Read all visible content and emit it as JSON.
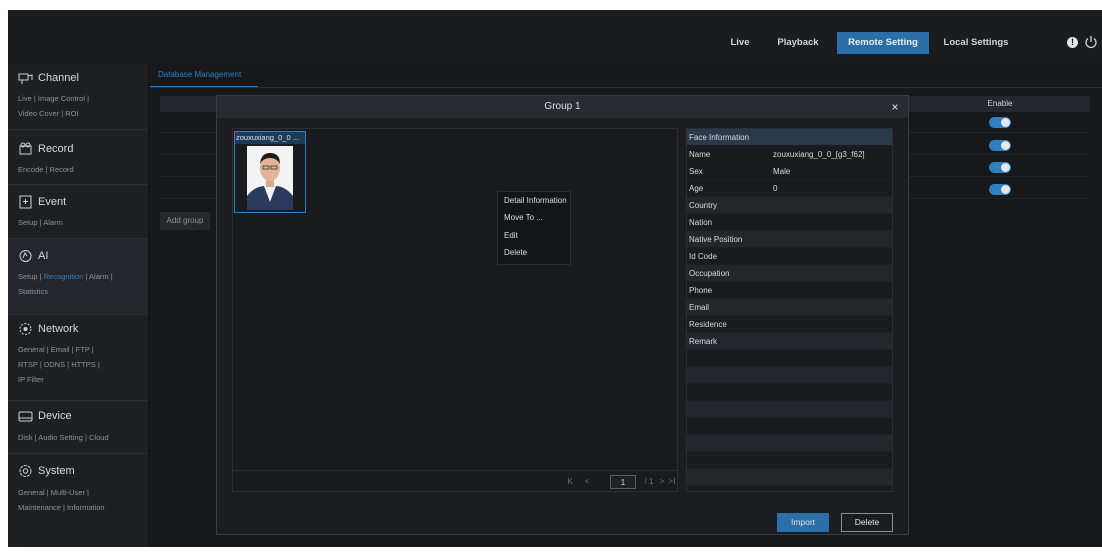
{
  "topbar": {
    "items": [
      {
        "label": "Live",
        "active": false
      },
      {
        "label": "Playback",
        "active": false
      },
      {
        "label": "Remote Setting",
        "active": true
      },
      {
        "label": "Local Settings",
        "active": false
      }
    ],
    "icons": [
      "alert-icon",
      "power-icon"
    ]
  },
  "sidebar": {
    "channel": {
      "title": "Channel",
      "links1": "Live | Image Control |",
      "links2": "Video Cover | ROI"
    },
    "record": {
      "title": "Record",
      "links1": "Encode | Record"
    },
    "event": {
      "title": "Event",
      "links1": "Setup | Alarm"
    },
    "ai": {
      "title": "AI",
      "l_setup": "Setup |",
      "l_recognition": "Recognition",
      "l_alarm": "| Alarm |",
      "links2": "Statistics"
    },
    "network": {
      "title": "Network",
      "links1": "General | Email | FTP |",
      "links2": "RTSP | DDNS | HTTPS |",
      "links3": "IP Filter"
    },
    "device": {
      "title": "Device",
      "links1": "Disk | Audio Setting | Cloud"
    },
    "system": {
      "title": "System",
      "links1": "General | Multi-User |",
      "links2": "Maintenance | Information"
    }
  },
  "main": {
    "tab": "Database Management",
    "enable_header": "Enable",
    "add_group": "Add group"
  },
  "dialog": {
    "title": "Group 1",
    "close": "×",
    "face_card_name": "zouxuxiang_0_0 ...",
    "context_menu": [
      "Detail Information",
      "Move To ...",
      "Edit",
      "Delete"
    ],
    "pager": {
      "first": "K",
      "prev": "<",
      "current": "1",
      "total": "/ 1",
      "next": ">",
      "last": ">I"
    },
    "info_header": "Face Information",
    "info_rows": [
      {
        "label": "Name",
        "value": "zouxuxiang_0_0_[g3_f62]"
      },
      {
        "label": "Sex",
        "value": "Male"
      },
      {
        "label": "Age",
        "value": "0"
      },
      {
        "label": "Country",
        "value": ""
      },
      {
        "label": "Nation",
        "value": ""
      },
      {
        "label": "Native Position",
        "value": ""
      },
      {
        "label": "Id Code",
        "value": ""
      },
      {
        "label": "Occupation",
        "value": ""
      },
      {
        "label": "Phone",
        "value": ""
      },
      {
        "label": "Email",
        "value": ""
      },
      {
        "label": "Residence",
        "value": ""
      },
      {
        "label": "Remark",
        "value": ""
      }
    ],
    "import_label": "Import",
    "delete_label": "Delete"
  },
  "colors": {
    "accent": "#2f7fc1",
    "active_nav": "#2a6fa8",
    "background": "#141518"
  }
}
